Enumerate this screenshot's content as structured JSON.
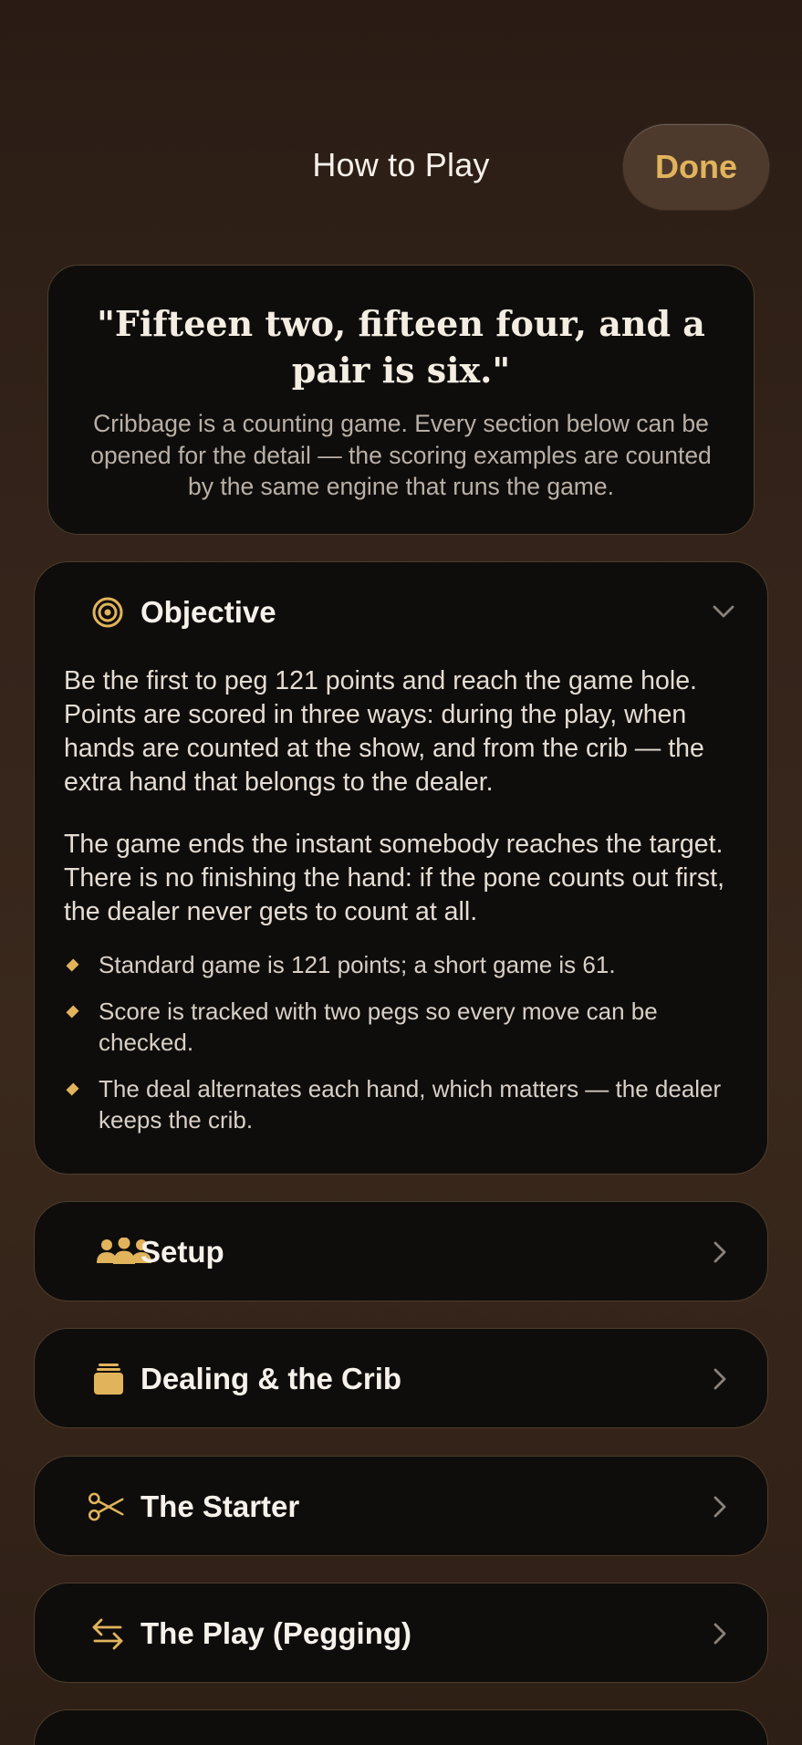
{
  "header": {
    "title": "How to Play",
    "done_label": "Done"
  },
  "intro": {
    "quote": "\"Fifteen two, fifteen four, and a pair is six.\"",
    "body": "Cribbage is a counting game. Every section below can be opened for the detail — the scoring examples are counted by the same engine that runs the game."
  },
  "objective": {
    "title": "Objective",
    "icon": "target-icon",
    "expanded": true,
    "paragraphs": [
      "Be the first to peg 121 points and reach the game hole. Points are scored in three ways: during the play, when hands are counted at the show, and from the crib — the extra hand that belongs to the dealer.",
      "The game ends the instant somebody reaches the target. There is no finishing the hand: if the pone counts out first, the dealer never gets to count at all."
    ],
    "bullets": [
      "Standard game is 121 points; a short game is 61.",
      "Score is tracked with two pegs so every move can be checked.",
      "The deal alternates each hand, which matters — the dealer keeps the crib."
    ]
  },
  "sections": [
    {
      "title": "Setup",
      "icon": "people-icon"
    },
    {
      "title": "Dealing & the Crib",
      "icon": "card-stack-icon"
    },
    {
      "title": "The Starter",
      "icon": "scissors-icon"
    },
    {
      "title": "The Play (Pegging)",
      "icon": "swap-arrows-icon"
    }
  ],
  "colors": {
    "accent": "#e1b45c",
    "card_bg": "#0f0d0c",
    "card_border": "#4d3e2a"
  }
}
